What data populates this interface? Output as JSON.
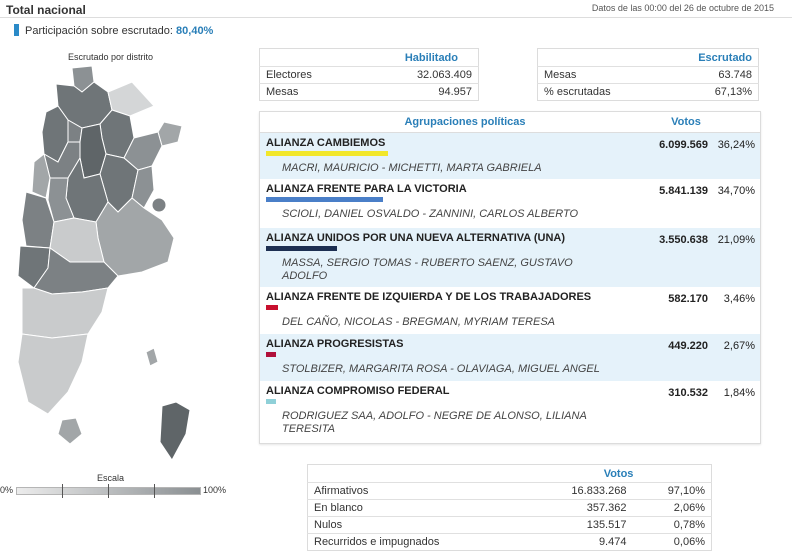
{
  "header": {
    "title": "Total nacional",
    "datestamp": "Datos de las 00:00 del 26 de octubre de 2015",
    "participation_label": "Participación sobre escrutado:",
    "participation_value": "80,40%"
  },
  "map": {
    "label": "Escrutado por distrito",
    "scale_label": "Escala",
    "scale_min": "0%",
    "scale_max": "100%"
  },
  "habilitado": {
    "header": "Habilitado",
    "rows": [
      {
        "label": "Electores",
        "value": "32.063.409"
      },
      {
        "label": "Mesas",
        "value": "94.957"
      }
    ]
  },
  "escrutado": {
    "header": "Escrutado",
    "rows": [
      {
        "label": "Mesas",
        "value": "63.748"
      },
      {
        "label": "% escrutadas",
        "value": "67,13%"
      }
    ]
  },
  "parties": {
    "header_name": "Agrupaciones políticas",
    "header_votes": "Votos",
    "rows": [
      {
        "name": "ALIANZA CAMBIEMOS",
        "candidates": "MACRI, MAURICIO - MICHETTI, MARTA GABRIELA",
        "votes": "6.099.569",
        "pct": "36,24%",
        "color": "#f2e72a",
        "share": 36.24
      },
      {
        "name": "ALIANZA FRENTE PARA LA VICTORIA",
        "candidates": "SCIOLI, DANIEL OSVALDO - ZANNINI, CARLOS ALBERTO",
        "votes": "5.841.139",
        "pct": "34,70%",
        "color": "#4a7fc8",
        "share": 34.7
      },
      {
        "name": "ALIANZA UNIDOS POR UNA NUEVA ALTERNATIVA (UNA)",
        "candidates": "MASSA, SERGIO TOMAS - RUBERTO SAENZ, GUSTAVO ADOLFO",
        "votes": "3.550.638",
        "pct": "21,09%",
        "color": "#1d2f52",
        "share": 21.09
      },
      {
        "name": "ALIANZA FRENTE DE IZQUIERDA Y DE LOS TRABAJADORES",
        "candidates": "DEL CAÑO, NICOLAS - BREGMAN, MYRIAM TERESA",
        "votes": "582.170",
        "pct": "3,46%",
        "color": "#c8102e",
        "share": 3.46
      },
      {
        "name": "ALIANZA PROGRESISTAS",
        "candidates": "STOLBIZER, MARGARITA ROSA - OLAVIAGA, MIGUEL ANGEL",
        "votes": "449.220",
        "pct": "2,67%",
        "color": "#b0103a",
        "share": 2.67
      },
      {
        "name": "ALIANZA COMPROMISO FEDERAL",
        "candidates": "RODRIGUEZ SAA, ADOLFO - NEGRE DE ALONSO, LILIANA TERESITA",
        "votes": "310.532",
        "pct": "1,84%",
        "color": "#8fd0d8",
        "share": 1.84
      }
    ]
  },
  "summary": {
    "header": "Votos",
    "rows": [
      {
        "label": "Afirmativos",
        "value": "16.833.268",
        "pct": "97,10%"
      },
      {
        "label": "En blanco",
        "value": "357.362",
        "pct": "2,06%"
      },
      {
        "label": "Nulos",
        "value": "135.517",
        "pct": "0,78%"
      },
      {
        "label": "Recurridos e impugnados",
        "value": "9.474",
        "pct": "0,06%"
      }
    ]
  }
}
